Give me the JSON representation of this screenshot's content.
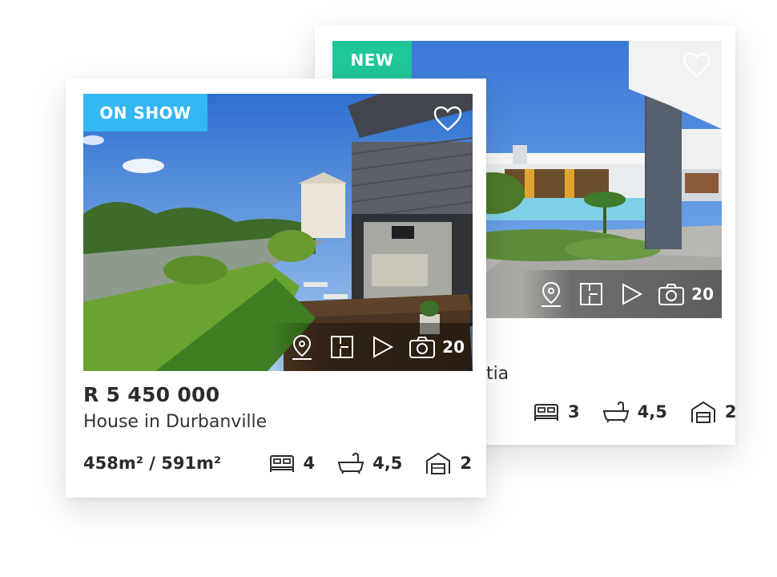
{
  "colors": {
    "new_badge": "#1fc799",
    "show_badge": "#35b7f3",
    "text": "#2b2b2b"
  },
  "back_card": {
    "badge": "NEW",
    "photo_count": "20",
    "title_visible": "ntia",
    "bedrooms": "3",
    "bathrooms": "4,5",
    "garages": "2",
    "icons": [
      "heart-icon",
      "map-pin-icon",
      "floorplan-icon",
      "play-icon",
      "camera-icon",
      "bed-icon",
      "bath-icon",
      "garage-icon"
    ]
  },
  "front_card": {
    "badge": "ON SHOW",
    "photo_count": "20",
    "price": "R 5 450 000",
    "title": "House in Durbanville",
    "area": "458m² / 591m²",
    "bedrooms": "4",
    "bathrooms": "4,5",
    "garages": "2",
    "icons": [
      "heart-icon",
      "map-pin-icon",
      "floorplan-icon",
      "play-icon",
      "camera-icon",
      "bed-icon",
      "bath-icon",
      "garage-icon"
    ]
  }
}
